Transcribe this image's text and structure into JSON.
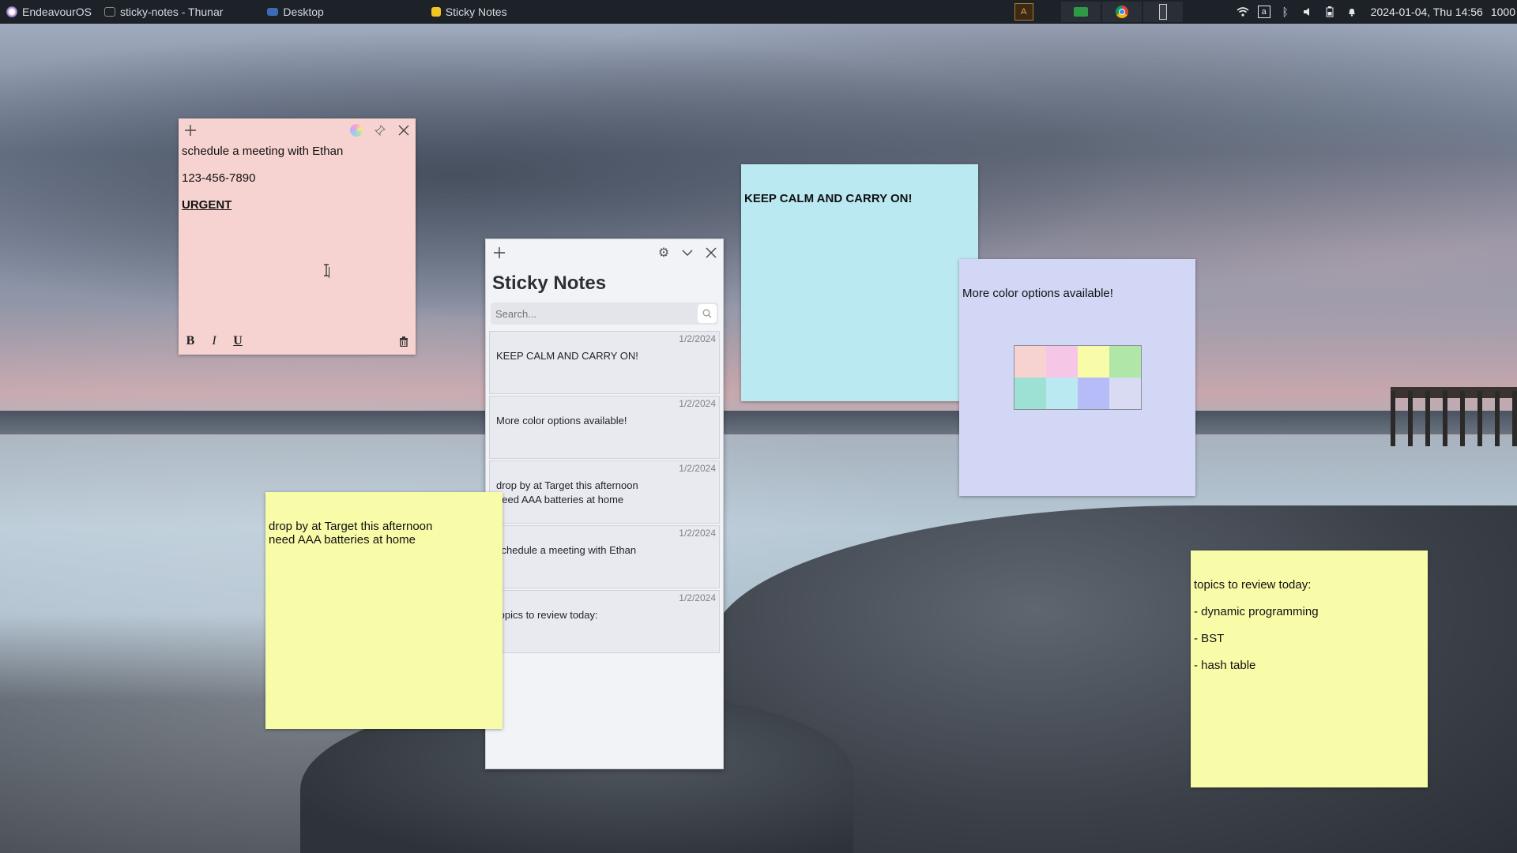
{
  "taskbar": {
    "start_label": "EndeavourOS",
    "windows": [
      {
        "label": "sticky-notes - Thunar"
      },
      {
        "label": "Desktop"
      },
      {
        "label": "Sticky Notes"
      }
    ],
    "clock": "2024-01-04, Thu  14:56",
    "extra": "1000"
  },
  "manager": {
    "title": "Sticky Notes",
    "search_placeholder": "Search...",
    "entries": [
      {
        "date": "1/2/2024",
        "text": "KEEP CALM AND CARRY ON!"
      },
      {
        "date": "1/2/2024",
        "text": "More color options available!"
      },
      {
        "date": "1/2/2024",
        "text": "drop by at Target this afternoon\nneed AAA batteries at home"
      },
      {
        "date": "1/2/2024",
        "text": "schedule a meeting with Ethan"
      },
      {
        "date": "1/2/2024",
        "text": "topics to review today:"
      }
    ]
  },
  "notes": {
    "pink": {
      "color": "#f6d3d0",
      "line1": "schedule a meeting with Ethan",
      "line2": "123-456-7890",
      "line3": "URGENT"
    },
    "blue": {
      "color": "#bbe9f2",
      "text": "KEEP CALM AND CARRY ON!"
    },
    "lavender": {
      "color": "#d2d7f6",
      "text": "More color options available!"
    },
    "yellow1": {
      "color": "#f8fca8",
      "line1": "drop by at Target this afternoon",
      "line2": "need AAA batteries at home"
    },
    "yellow2": {
      "color": "#f8fca8",
      "line1": "topics to review today:",
      "line2": "- dynamic programming",
      "line3": "- BST",
      "line4": "- hash table"
    }
  },
  "palette": [
    "#f6d3d0",
    "#f6c6e6",
    "#f8fca8",
    "#b0e6a8",
    "#9de0d4",
    "#bbe9f2",
    "#b6bcf8",
    "#d8dbf1"
  ]
}
